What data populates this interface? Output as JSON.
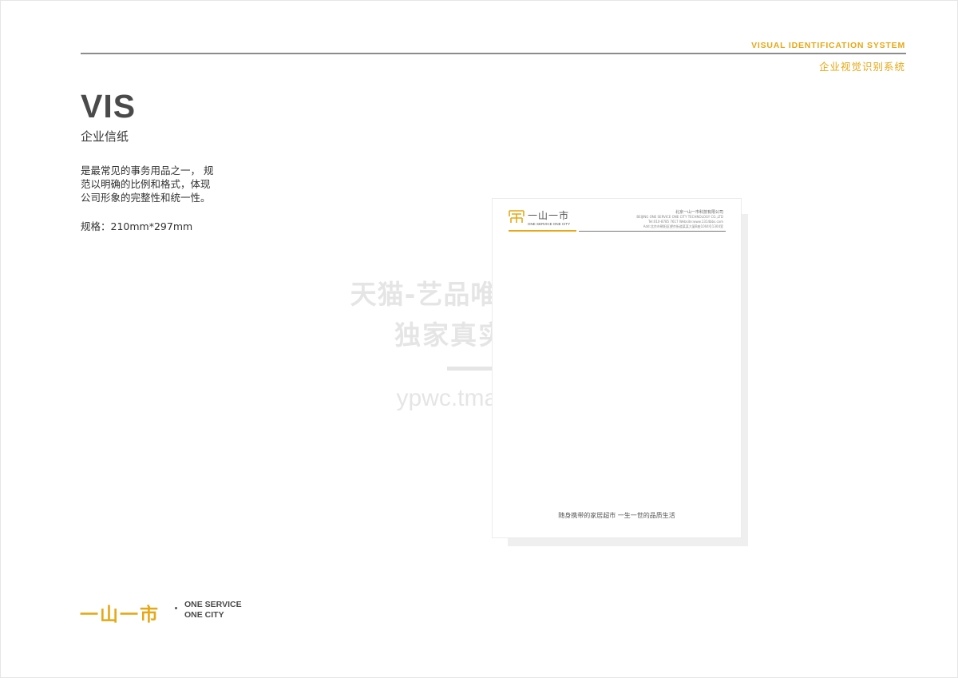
{
  "header": {
    "title_en": "VISUAL IDENTIFICATION SYSTEM",
    "title_cn": "企业视觉识别系统",
    "accent_color": "#e6a817"
  },
  "section": {
    "title": "VIS",
    "subtitle": "企业信纸",
    "description_lines": [
      "是最常见的事务用品之一， 规",
      "范以明确的比例和格式，体现",
      "公司形象的完整性和统一性。"
    ],
    "spec": "规格：210mm*297mm"
  },
  "brand": {
    "name_cn": "一山一市",
    "slogan_line1": "ONE SERVICE",
    "slogan_line2": "ONE CITY"
  },
  "letterhead": {
    "logo_name": "一山一市",
    "logo_slogan": "ONE SERVICE ONE CITY",
    "company_cn": "北京一山一市科技有限公司",
    "company_en": "BEIJING ONE SERVICE ONE CITY TECHNOLOGY CO.,LTD",
    "contact": "Tel:010-8785 7617  Website:www.1314bbs.com",
    "address": "Add:北京市朝阳区望京街道某某大厦B座1004号1304室",
    "footer": "随身携带的家居超市  一生一世的品质生活"
  },
  "watermark": {
    "line1": "天猫-艺品唯创旗舰店",
    "line2": "独家真实案例",
    "url": "ypwc.tmall.com"
  }
}
